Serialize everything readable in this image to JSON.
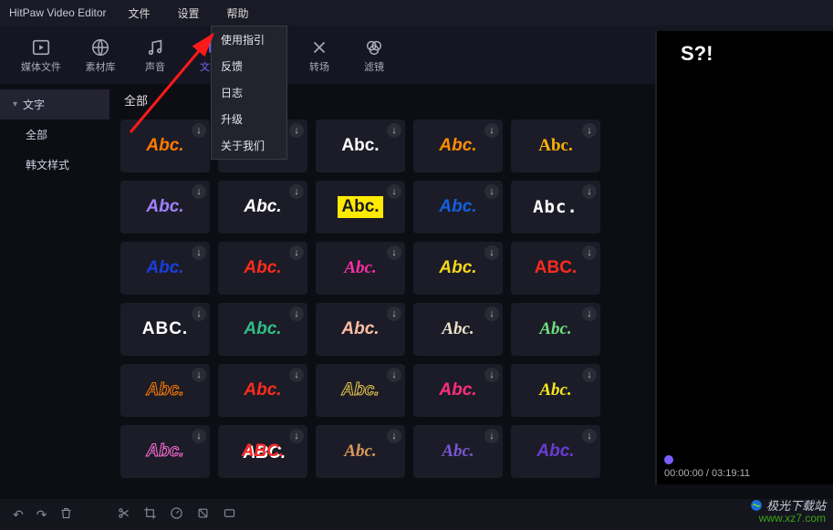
{
  "app_title": "HitPaw Video Editor",
  "menu": {
    "file": "文件",
    "settings": "设置",
    "help": "帮助"
  },
  "help_menu": [
    "使用指引",
    "反馈",
    "日志",
    "升级",
    "关于我们"
  ],
  "toolbar": {
    "media": "媒体文件",
    "library": "素材库",
    "audio": "声音",
    "text": "文字",
    "transition": "转场",
    "filter": "滤镜"
  },
  "sidebar": {
    "text_header": "文字",
    "all": "全部",
    "korean": "韩文样式"
  },
  "section_title": "全部",
  "tile_label": "Abc.",
  "tile_abc_variant": "ABC.",
  "download_glyph": "↓",
  "styles": [
    {
      "color": "#ff7a00",
      "style": "italic bold",
      "text": "Abc."
    },
    {
      "color": "#ffffff",
      "style": "bold",
      "text": "Abc."
    },
    {
      "color": "#ffffff",
      "style": "slab",
      "text": "Abc."
    },
    {
      "color": "#ff8c00",
      "style": "bold",
      "text": "Abc."
    },
    {
      "color": "#ffb300",
      "style": "retro",
      "text": "Abc."
    },
    {
      "color": "#9f82ff",
      "style": "italic bold",
      "text": "Abc."
    },
    {
      "color": "#ffffff",
      "style": "italic bold",
      "text": "Abc."
    },
    {
      "color": "#ffeb00",
      "style": "box",
      "text": "Abc.",
      "bg": "#ffeb00",
      "fg": "#1a1a26"
    },
    {
      "color": "#1261e0",
      "style": "italic bold",
      "text": "Abc."
    },
    {
      "color": "#ffffff",
      "style": "pixel",
      "text": "Abc."
    },
    {
      "color": "#1b3de0",
      "style": "italic bold",
      "text": "Abc."
    },
    {
      "color": "#ff2b1c",
      "style": "italic bold",
      "text": "Abc."
    },
    {
      "color": "#ff2ea6",
      "style": "script",
      "text": "Abc."
    },
    {
      "color": "#f4d51a",
      "style": "italic bold",
      "text": "Abc."
    },
    {
      "color": "#ff2b1c",
      "style": "caps",
      "text": "ABC."
    },
    {
      "color": "#ffffff",
      "style": "stencil",
      "text": "ABC."
    },
    {
      "color": "#2fbf87",
      "style": "italic bold",
      "text": "Abc."
    },
    {
      "color": "#ffbda1",
      "style": "italic",
      "text": "Abc."
    },
    {
      "color": "#e9e2c9",
      "style": "serif",
      "text": "Abc."
    },
    {
      "color": "#70e07e",
      "style": "script",
      "text": "Abc."
    },
    {
      "color": "#ff7a00",
      "style": "outline",
      "text": "Abc."
    },
    {
      "color": "#ff2b1c",
      "style": "italic bold",
      "text": "Abc."
    },
    {
      "color": "#e2c24a",
      "style": "outline",
      "text": "Abc."
    },
    {
      "color": "#ff2e7a",
      "style": "italic bold",
      "text": "Abc."
    },
    {
      "color": "#f4e81a",
      "style": "comic",
      "text": "Abc."
    },
    {
      "color": "#ff6bd6",
      "style": "italic bold outline",
      "text": "Abc."
    },
    {
      "color": "#ff2a2a",
      "style": "italic bold shadow",
      "text": "ABC."
    },
    {
      "color": "#d99a58",
      "style": "cursive",
      "text": "Abc."
    },
    {
      "color": "#7a56d1",
      "style": "serif italic",
      "text": "Abc."
    },
    {
      "color": "#6a3bd1",
      "style": "italic bold",
      "text": "Abc."
    }
  ],
  "preview": {
    "overlay": "S?!",
    "time_current": "00:00:00",
    "time_total": "03:19:11"
  },
  "watermark": {
    "line1": "极光下载站",
    "line2": "www.xz7.com"
  }
}
